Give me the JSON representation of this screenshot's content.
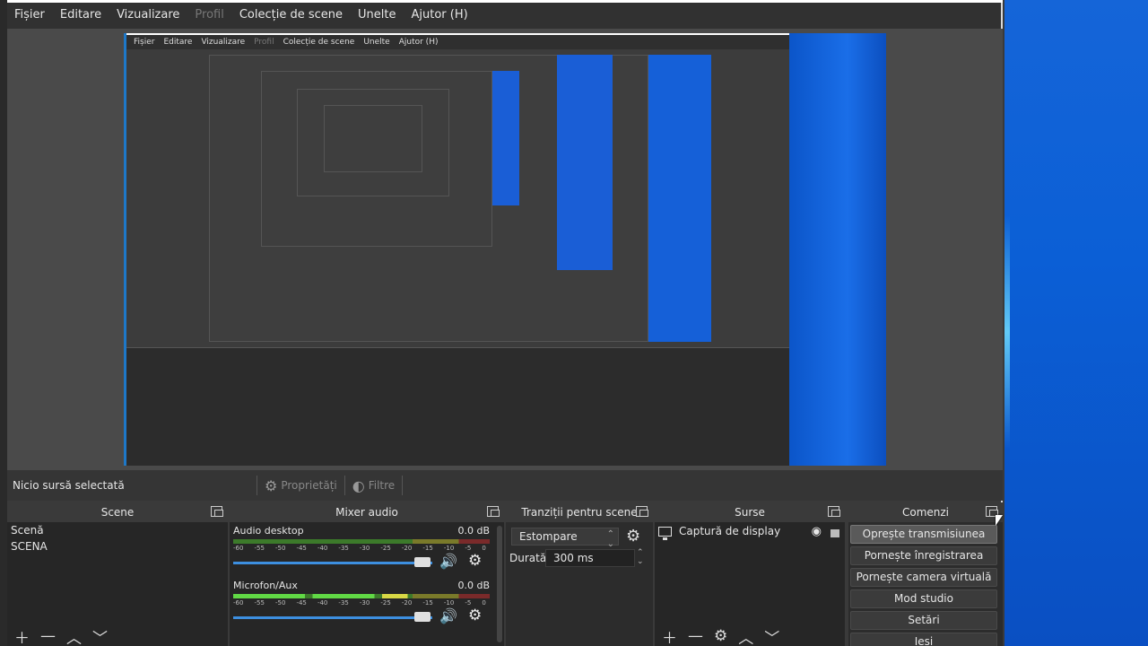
{
  "menu": [
    "Fișier",
    "Editare",
    "Vizualizare",
    "Profil",
    "Colecție de scene",
    "Unelte",
    "Ajutor (H)"
  ],
  "menu_disabled_index": 3,
  "nested_menu": [
    "Fișier",
    "Editare",
    "Vizualizare",
    "Profil",
    "Colecție de scene",
    "Unelte",
    "Ajutor (H)"
  ],
  "source_bar": {
    "no_source": "Nicio sursă selectată",
    "properties": "Proprietăți",
    "filters": "Filtre"
  },
  "scenes": {
    "title": "Scene",
    "items": [
      "Scenă",
      "SCENA"
    ]
  },
  "mixer": {
    "title": "Mixer audio",
    "channels": [
      {
        "name": "Audio desktop",
        "db": "0.0 dB",
        "active": false
      },
      {
        "name": "Microfon/Aux",
        "db": "0.0 dB",
        "active": true
      }
    ],
    "ticks": [
      "-60",
      "-55",
      "-50",
      "-45",
      "-40",
      "-35",
      "-30",
      "-25",
      "-20",
      "-15",
      "-10",
      "-5",
      "0"
    ]
  },
  "transitions": {
    "title": "Tranziții pentru scene",
    "selected": "Estompare",
    "duration_label": "Durată",
    "duration": "300 ms"
  },
  "sources": {
    "title": "Surse",
    "items": [
      "Captură de display"
    ]
  },
  "commands": {
    "title": "Comenzi",
    "buttons": [
      "Oprește transmisiunea",
      "Pornește înregistrarea",
      "Pornește camera virtuală",
      "Mod studio",
      "Setări",
      "Ieși"
    ]
  },
  "colors": {
    "desktop_blue": "#0b5fd6",
    "accent": "#3d8fe0",
    "meter_green": "#61d945"
  }
}
